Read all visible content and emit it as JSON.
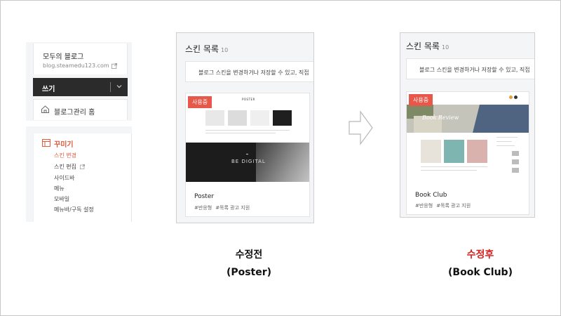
{
  "sidebar": {
    "blog_name": "모두의 블로그",
    "blog_url": "blog.steamedu123.com",
    "write_label": "쓰기",
    "admin_home_label": "블로그관리 홈",
    "decorate": {
      "title": "꾸미기",
      "items": [
        {
          "label": "스킨 변경",
          "active": true
        },
        {
          "label": "스킨 편집",
          "external": true
        },
        {
          "label": "사이드바"
        },
        {
          "label": "메뉴"
        },
        {
          "label": "모바일"
        },
        {
          "label": "메뉴바/구독 설정"
        }
      ]
    },
    "accent_color": "#e15a3c"
  },
  "before_panel": {
    "title": "스킨 목록",
    "count": "10",
    "description": "블로그 스킨을 변경하거나 저장할 수 있고, 직접",
    "badge": "사용중",
    "skin_name": "Poster",
    "tags": [
      "#반응형",
      "#목록 광고 지원"
    ],
    "preview_logo": "POSTER",
    "preview_banner_text": "BE DIGITAL"
  },
  "after_panel": {
    "title": "스킨 목록",
    "count": "10",
    "description": "블로그 스킨을 변경하거나 저장할 수 있고, 직접",
    "badge": "사용중",
    "skin_name": "Book Club",
    "tags": [
      "#반응형",
      "#목록 광고 지원"
    ],
    "preview_banner_text": "Book Review"
  },
  "arrow_icon": "right-arrow-icon",
  "captions": {
    "before": "수정전",
    "before_sub": "(Poster)",
    "after": "수정후",
    "after_sub": "(Book Club)",
    "after_color": "#d32020"
  }
}
